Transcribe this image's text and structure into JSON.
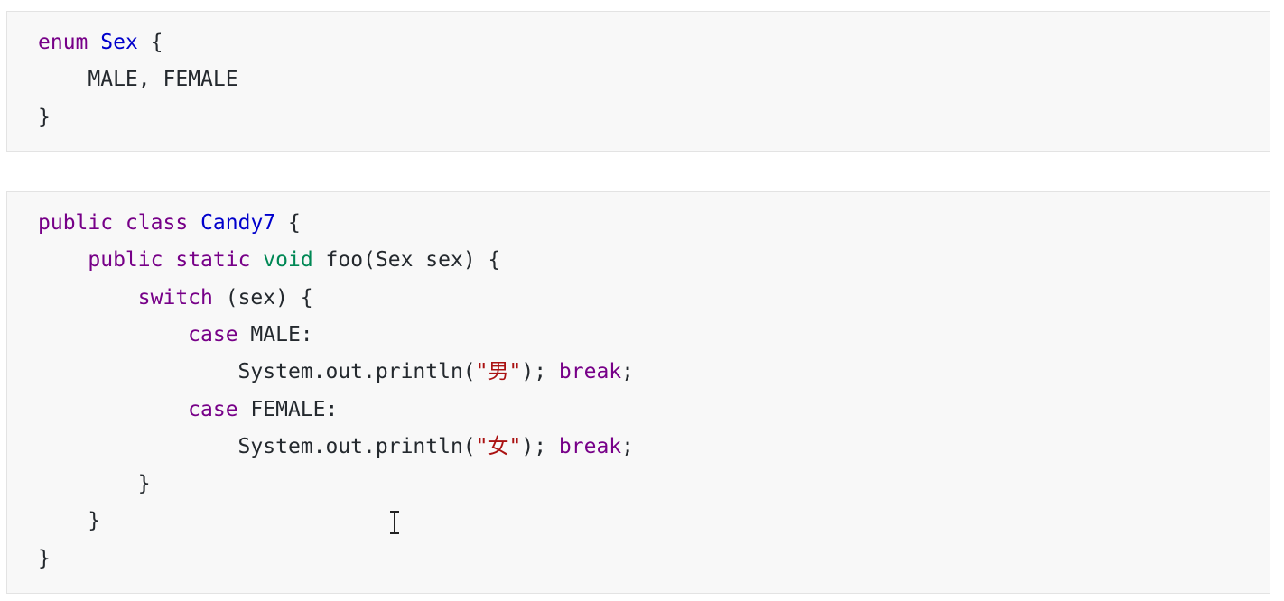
{
  "colors": {
    "keyword": "#770088",
    "type_name": "#0000cc",
    "void_type": "#008855",
    "string": "#aa1111",
    "text": "#24292e",
    "block_background": "#f8f8f8",
    "block_border": "#e3e3e3"
  },
  "code_blocks": [
    {
      "lines": [
        [
          [
            "kw",
            "enum"
          ],
          [
            "tx",
            " "
          ],
          [
            "ty",
            "Sex"
          ],
          [
            "tx",
            " {"
          ]
        ],
        [
          [
            "tx",
            "    MALE, FEMALE"
          ]
        ],
        [
          [
            "tx",
            "}"
          ]
        ]
      ]
    },
    {
      "lines": [
        [
          [
            "kw",
            "public"
          ],
          [
            "tx",
            " "
          ],
          [
            "kw",
            "class"
          ],
          [
            "tx",
            " "
          ],
          [
            "ty",
            "Candy7"
          ],
          [
            "tx",
            " {"
          ]
        ],
        [
          [
            "tx",
            "    "
          ],
          [
            "kw",
            "public"
          ],
          [
            "tx",
            " "
          ],
          [
            "kw",
            "static"
          ],
          [
            "tx",
            " "
          ],
          [
            "vt",
            "void"
          ],
          [
            "tx",
            " foo(Sex sex) {"
          ]
        ],
        [
          [
            "tx",
            "        "
          ],
          [
            "kw",
            "switch"
          ],
          [
            "tx",
            " (sex) {"
          ]
        ],
        [
          [
            "tx",
            "            "
          ],
          [
            "kw",
            "case"
          ],
          [
            "tx",
            " MALE:"
          ]
        ],
        [
          [
            "tx",
            "                System.out.println("
          ],
          [
            "st",
            "\"男\""
          ],
          [
            "tx",
            "); "
          ],
          [
            "kw",
            "break"
          ],
          [
            "tx",
            ";"
          ]
        ],
        [
          [
            "tx",
            "            "
          ],
          [
            "kw",
            "case"
          ],
          [
            "tx",
            " FEMALE:"
          ]
        ],
        [
          [
            "tx",
            "                System.out.println("
          ],
          [
            "st",
            "\"女\""
          ],
          [
            "tx",
            "); "
          ],
          [
            "kw",
            "break"
          ],
          [
            "tx",
            ";"
          ]
        ],
        [
          [
            "tx",
            "        }"
          ]
        ],
        [
          [
            "tx",
            "    }"
          ]
        ],
        [
          [
            "tx",
            "}"
          ]
        ]
      ]
    }
  ],
  "cursor": {
    "icon": "text-cursor-icon"
  }
}
